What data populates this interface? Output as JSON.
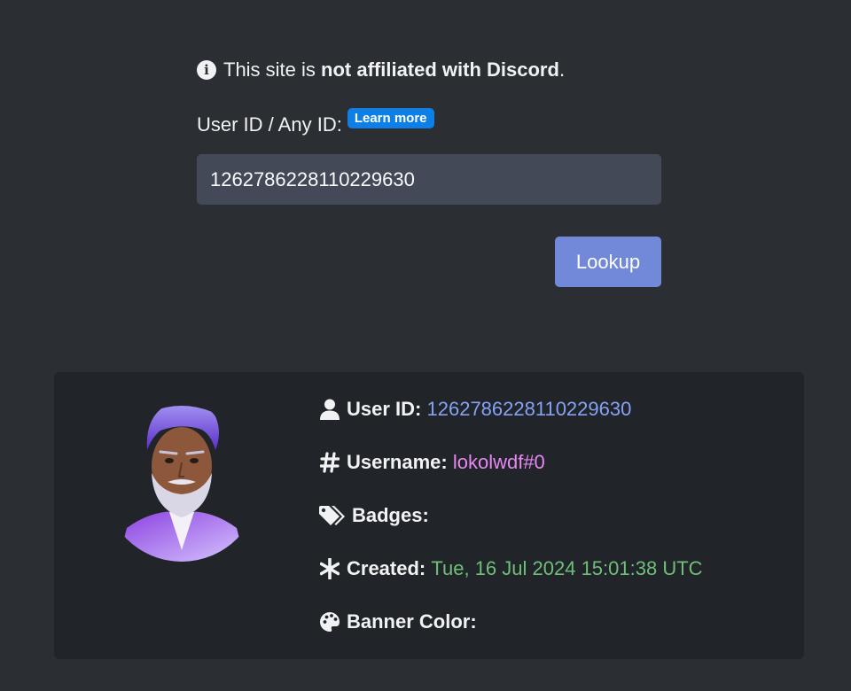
{
  "notice": {
    "prefix": "This site is ",
    "bold": "not affiliated with Discord",
    "suffix": "."
  },
  "lookup_form": {
    "label": "User ID / Any ID:",
    "learn_more": "Learn more",
    "input_value": "1262786228110229630",
    "button_label": "Lookup"
  },
  "profile": {
    "user_id_label": "User ID",
    "user_id_value": "1262786228110229630",
    "username_label": "Username",
    "username_value": "lokolwdf#0",
    "badges_label": "Badges:",
    "created_label": "Created",
    "created_value": "Tue, 16 Jul 2024 15:01:38 UTC",
    "banner_label": "Banner Color:",
    "colon": ":"
  },
  "colors": {
    "background": "#2b2e33",
    "card": "#212428",
    "input": "#434957",
    "button": "#7289da",
    "learn_badge": "#0d7fe6",
    "user_id": "#86a2f4",
    "username": "#e987f3",
    "created": "#6fbf7a"
  },
  "icons": [
    "info-circle-icon",
    "user-icon",
    "hashtag-icon",
    "tags-icon",
    "asterisk-icon",
    "palette-icon"
  ]
}
